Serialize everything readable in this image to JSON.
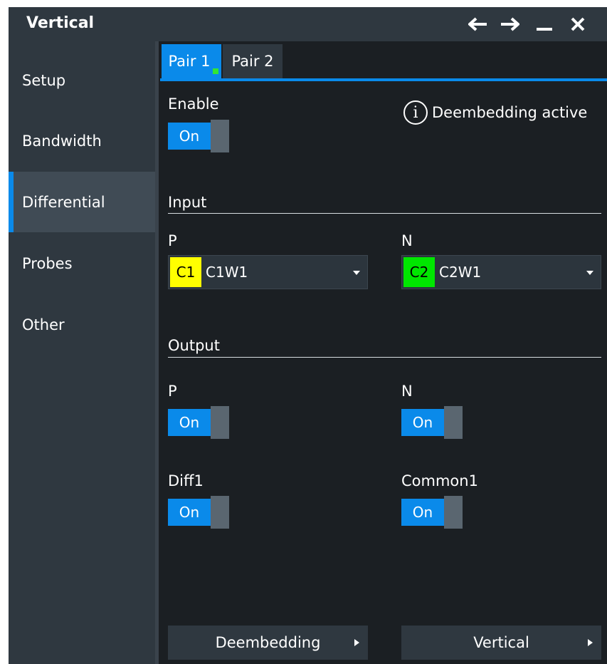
{
  "window": {
    "title": "Vertical"
  },
  "sidebar": {
    "items": [
      {
        "label": "Setup"
      },
      {
        "label": "Bandwidth"
      },
      {
        "label": "Differential"
      },
      {
        "label": "Probes"
      },
      {
        "label": "Other"
      }
    ],
    "active": "Differential"
  },
  "tabs": [
    {
      "label": "Pair 1"
    },
    {
      "label": "Pair 2"
    }
  ],
  "enable": {
    "label": "Enable",
    "state": "On"
  },
  "info": {
    "text": "Deembedding active"
  },
  "input": {
    "section": "Input",
    "p": {
      "label": "P",
      "chip": "C1",
      "chip_color": "#ffff00",
      "value": "C1W1"
    },
    "n": {
      "label": "N",
      "chip": "C2",
      "chip_color": "#00e600",
      "value": "C2W1"
    }
  },
  "output": {
    "section": "Output",
    "p": {
      "label": "P",
      "state": "On"
    },
    "n": {
      "label": "N",
      "state": "On"
    },
    "diff": {
      "label": "Diff1",
      "state": "On"
    },
    "common": {
      "label": "Common1",
      "state": "On"
    }
  },
  "buttons": {
    "deembedding": "Deembedding",
    "vertical": "Vertical"
  },
  "colors": {
    "accent": "#0a8aea",
    "panel": "#2f3840",
    "background": "#1b1f23"
  }
}
